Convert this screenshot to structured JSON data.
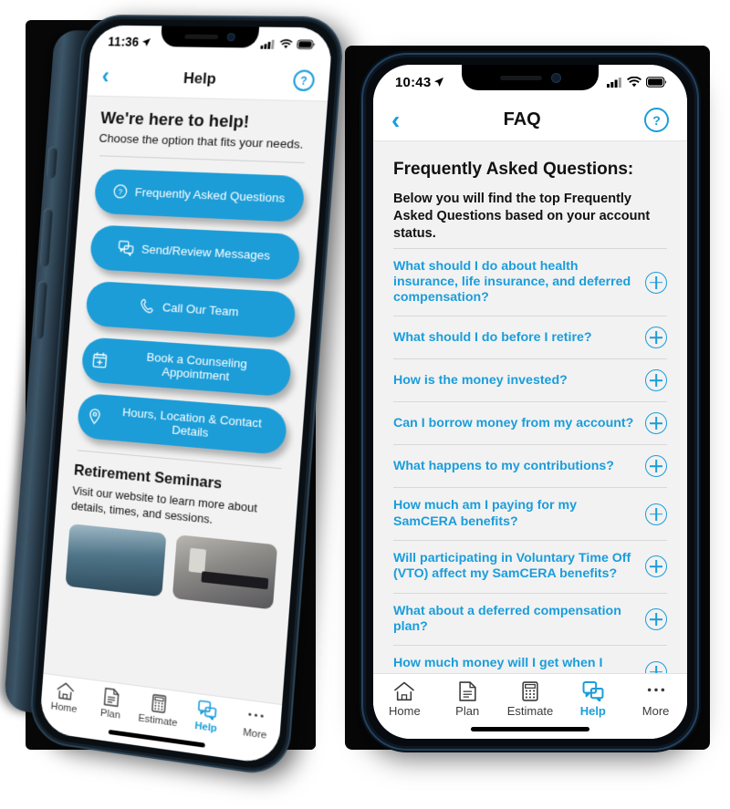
{
  "page": {
    "background_color": "#ffffff",
    "accent_color": "#1a9ddb",
    "plate_color": "#070707"
  },
  "left_phone": {
    "status_bar": {
      "time": "11:36",
      "location_icon": "location-arrow-icon",
      "cellular_icon": "cellular-bars-icon",
      "wifi_icon": "wifi-icon",
      "battery_icon": "battery-icon"
    },
    "nav": {
      "back_icon": "chevron-left-icon",
      "title": "Help",
      "help_icon": "question-mark-circle-icon",
      "help_label": "?"
    },
    "heading": "We're here to help!",
    "subheading": "Choose the option that fits your needs.",
    "options": [
      {
        "label": "Frequently Asked Questions",
        "icon": "question-mark-circle-icon"
      },
      {
        "label": "Send/Review Messages",
        "icon": "chat-bubbles-icon"
      },
      {
        "label": "Call Our Team",
        "icon": "phone-icon"
      },
      {
        "label": "Book a Counseling Appointment",
        "icon": "calendar-plus-icon"
      },
      {
        "label": "Hours, Location & Contact Details",
        "icon": "map-pin-icon"
      }
    ],
    "seminars": {
      "title": "Retirement Seminars",
      "description": "Visit our website to learn more about details, times, and sessions.",
      "thumbnails": [
        "seminar-photo-1",
        "seminar-photo-2"
      ]
    },
    "tabs": [
      {
        "label": "Home",
        "icon": "home-icon",
        "active": false
      },
      {
        "label": "Plan",
        "icon": "document-icon",
        "active": false
      },
      {
        "label": "Estimate",
        "icon": "calculator-icon",
        "active": false
      },
      {
        "label": "Help",
        "icon": "chat-bubbles-icon",
        "active": true
      },
      {
        "label": "More",
        "icon": "ellipsis-icon",
        "active": false
      }
    ]
  },
  "right_phone": {
    "status_bar": {
      "time": "10:43",
      "location_icon": "location-arrow-icon",
      "cellular_icon": "cellular-bars-icon",
      "wifi_icon": "wifi-icon",
      "battery_icon": "battery-icon"
    },
    "nav": {
      "back_icon": "chevron-left-icon",
      "title": "FAQ",
      "help_icon": "question-mark-circle-icon",
      "help_label": "?"
    },
    "heading": "Frequently Asked Questions:",
    "intro": "Below you will find the top Frequently Asked Questions based on your account status.",
    "faqs": [
      {
        "question": "What should I do about health insurance, life insurance, and deferred compensation?",
        "expand_icon": "plus-circle-icon"
      },
      {
        "question": "What  should I do before I retire?",
        "expand_icon": "plus-circle-icon"
      },
      {
        "question": "How is the money invested?",
        "expand_icon": "plus-circle-icon"
      },
      {
        "question": "Can I borrow money from my account?",
        "expand_icon": "plus-circle-icon"
      },
      {
        "question": "What happens to my contributions?",
        "expand_icon": "plus-circle-icon"
      },
      {
        "question": "How much am I paying for my SamCERA benefits?",
        "expand_icon": "plus-circle-icon"
      },
      {
        "question": "Will participating in Voluntary Time Off (VTO) affect my SamCERA benefits?",
        "expand_icon": "plus-circle-icon"
      },
      {
        "question": "What about a deferred compensation plan?",
        "expand_icon": "plus-circle-icon"
      },
      {
        "question": "How much money will I get when I retire?",
        "expand_icon": "plus-circle-icon"
      }
    ],
    "tabs": [
      {
        "label": "Home",
        "icon": "home-icon",
        "active": false
      },
      {
        "label": "Plan",
        "icon": "document-icon",
        "active": false
      },
      {
        "label": "Estimate",
        "icon": "calculator-icon",
        "active": false
      },
      {
        "label": "Help",
        "icon": "chat-bubbles-icon",
        "active": true
      },
      {
        "label": "More",
        "icon": "ellipsis-icon",
        "active": false
      }
    ]
  }
}
